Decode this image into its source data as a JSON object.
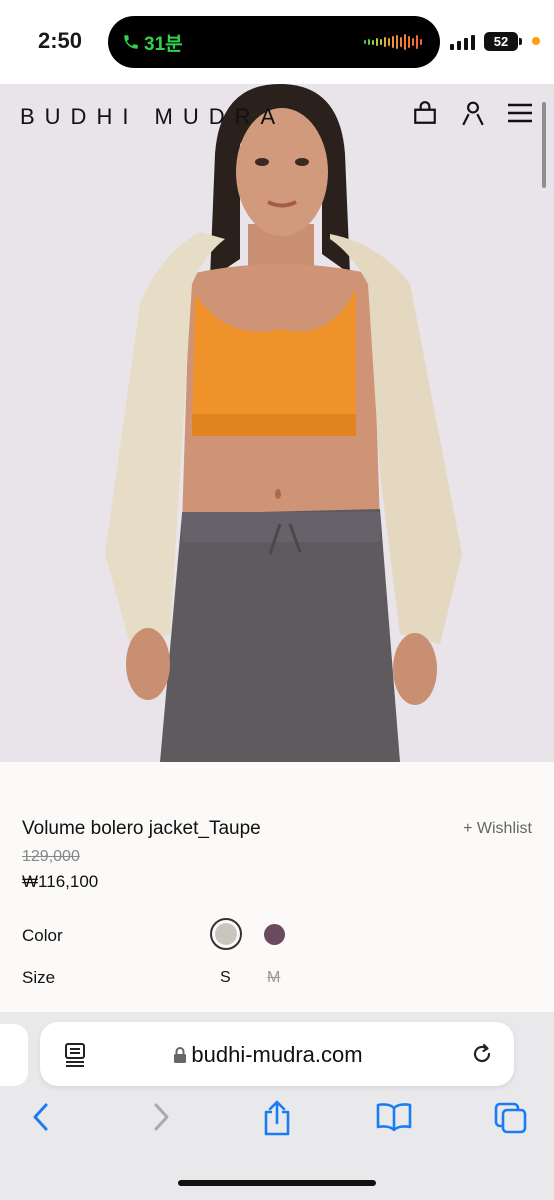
{
  "status_bar": {
    "time": "2:50",
    "call_duration": "31분",
    "battery_level": "52",
    "accent_green": "#33d04c",
    "privacy_dot_color": "#ff9f0a"
  },
  "header": {
    "brand": "BUDHI MUDRA",
    "icons": [
      "shopping-bag-icon",
      "account-icon",
      "menu-icon"
    ]
  },
  "product": {
    "title": "Volume bolero jacket_Taupe",
    "wishlist_label": "+ Wishlist",
    "original_price": "129,000",
    "sale_price": "₩116,100",
    "color_label": "Color",
    "colors": [
      "#c9c5bf",
      "#6b4a5e"
    ],
    "selected_color": "#c9c5bf",
    "size_label": "Size",
    "sizes": [
      {
        "label": "S",
        "available": true
      },
      {
        "label": "M",
        "available": false
      }
    ]
  },
  "browser": {
    "url": "budhi-mudra.com",
    "toolbar_icons": [
      "back-icon",
      "forward-icon",
      "share-icon",
      "bookmarks-icon",
      "tabs-icon"
    ],
    "accent": "#1a7cf5"
  }
}
